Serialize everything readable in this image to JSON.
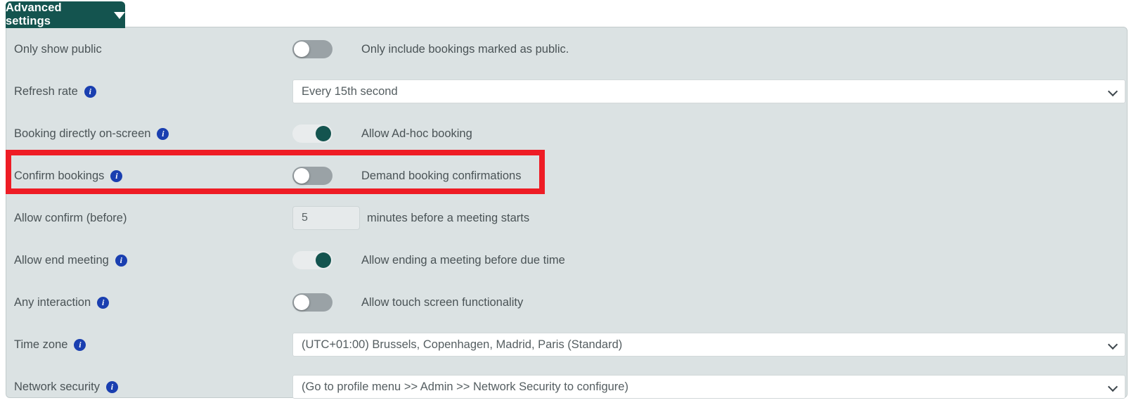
{
  "tab": {
    "label": "Advanced settings",
    "caret_icon": "chevron-down-icon",
    "color": "#14544f"
  },
  "panel": {
    "background": "#dbe2e3",
    "border_color": "#c3cccd"
  },
  "highlight": {
    "color": "#ee1c25",
    "target_row": "Confirm bookings"
  },
  "rows": [
    {
      "label": "Only show public",
      "has_info": false,
      "control": "toggle",
      "toggle_state": "off",
      "description": "Only include bookings marked as public."
    },
    {
      "label": "Refresh rate",
      "has_info": true,
      "control": "select",
      "value": "Every 15th second"
    },
    {
      "label": "Booking directly on-screen",
      "has_info": true,
      "control": "toggle",
      "toggle_state": "on",
      "description": "Allow Ad-hoc booking"
    },
    {
      "label": "Confirm bookings",
      "has_info": true,
      "control": "toggle",
      "toggle_state": "off",
      "description": "Demand booking confirmations"
    },
    {
      "label": "Allow confirm (before)",
      "has_info": false,
      "control": "number",
      "value": "5",
      "description": "minutes before a meeting starts"
    },
    {
      "label": "Allow end meeting",
      "has_info": true,
      "control": "toggle",
      "toggle_state": "on",
      "description": "Allow ending a meeting before due time"
    },
    {
      "label": "Any interaction",
      "has_info": true,
      "control": "toggle",
      "toggle_state": "off",
      "description": "Allow touch screen functionality"
    },
    {
      "label": "Time zone",
      "has_info": true,
      "control": "select",
      "value": "(UTC+01:00) Brussels, Copenhagen, Madrid, Paris (Standard)"
    },
    {
      "label": "Network security",
      "has_info": true,
      "control": "select",
      "value": "(Go to profile menu >> Admin >> Network Security to configure)"
    }
  ],
  "icons": {
    "info": "i",
    "info_color": "#1a3fb0"
  }
}
